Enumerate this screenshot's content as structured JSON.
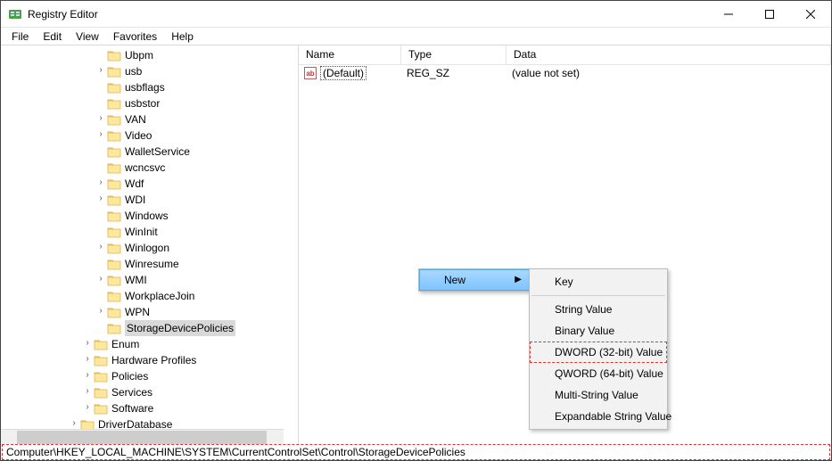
{
  "window": {
    "title": "Registry Editor"
  },
  "menubar": {
    "file": "File",
    "edit": "Edit",
    "view": "View",
    "favorites": "Favorites",
    "help": "Help"
  },
  "columns": {
    "name": "Name",
    "type": "Type",
    "data": "Data"
  },
  "tree": {
    "items": [
      {
        "label": "Ubpm",
        "indent": 7,
        "expand": "none"
      },
      {
        "label": "usb",
        "indent": 7,
        "expand": "closed"
      },
      {
        "label": "usbflags",
        "indent": 7,
        "expand": "none"
      },
      {
        "label": "usbstor",
        "indent": 7,
        "expand": "none"
      },
      {
        "label": "VAN",
        "indent": 7,
        "expand": "closed"
      },
      {
        "label": "Video",
        "indent": 7,
        "expand": "closed"
      },
      {
        "label": "WalletService",
        "indent": 7,
        "expand": "none"
      },
      {
        "label": "wcncsvc",
        "indent": 7,
        "expand": "none"
      },
      {
        "label": "Wdf",
        "indent": 7,
        "expand": "closed"
      },
      {
        "label": "WDI",
        "indent": 7,
        "expand": "closed"
      },
      {
        "label": "Windows",
        "indent": 7,
        "expand": "none"
      },
      {
        "label": "WinInit",
        "indent": 7,
        "expand": "none"
      },
      {
        "label": "Winlogon",
        "indent": 7,
        "expand": "closed"
      },
      {
        "label": "Winresume",
        "indent": 7,
        "expand": "none"
      },
      {
        "label": "WMI",
        "indent": 7,
        "expand": "closed"
      },
      {
        "label": "WorkplaceJoin",
        "indent": 7,
        "expand": "none"
      },
      {
        "label": "WPN",
        "indent": 7,
        "expand": "closed"
      },
      {
        "label": "StorageDevicePolicies",
        "indent": 7,
        "expand": "none",
        "selected": true
      },
      {
        "label": "Enum",
        "indent": 6,
        "expand": "closed"
      },
      {
        "label": "Hardware Profiles",
        "indent": 6,
        "expand": "closed"
      },
      {
        "label": "Policies",
        "indent": 6,
        "expand": "closed"
      },
      {
        "label": "Services",
        "indent": 6,
        "expand": "closed"
      },
      {
        "label": "Software",
        "indent": 6,
        "expand": "closed"
      },
      {
        "label": "DriverDatabase",
        "indent": 5,
        "expand": "closed",
        "cut": true
      }
    ]
  },
  "values_list": [
    {
      "name": "(Default)",
      "type": "REG_SZ",
      "data": "(value not set)"
    }
  ],
  "context_menu": {
    "parent": {
      "new": "New"
    },
    "sub": {
      "key": "Key",
      "string": "String Value",
      "binary": "Binary Value",
      "dword": "DWORD (32-bit) Value",
      "qword": "QWORD (64-bit) Value",
      "multi": "Multi-String Value",
      "expand": "Expandable String Value"
    }
  },
  "statusbar": {
    "path": "Computer\\HKEY_LOCAL_MACHINE\\SYSTEM\\CurrentControlSet\\Control\\StorageDevicePolicies"
  }
}
